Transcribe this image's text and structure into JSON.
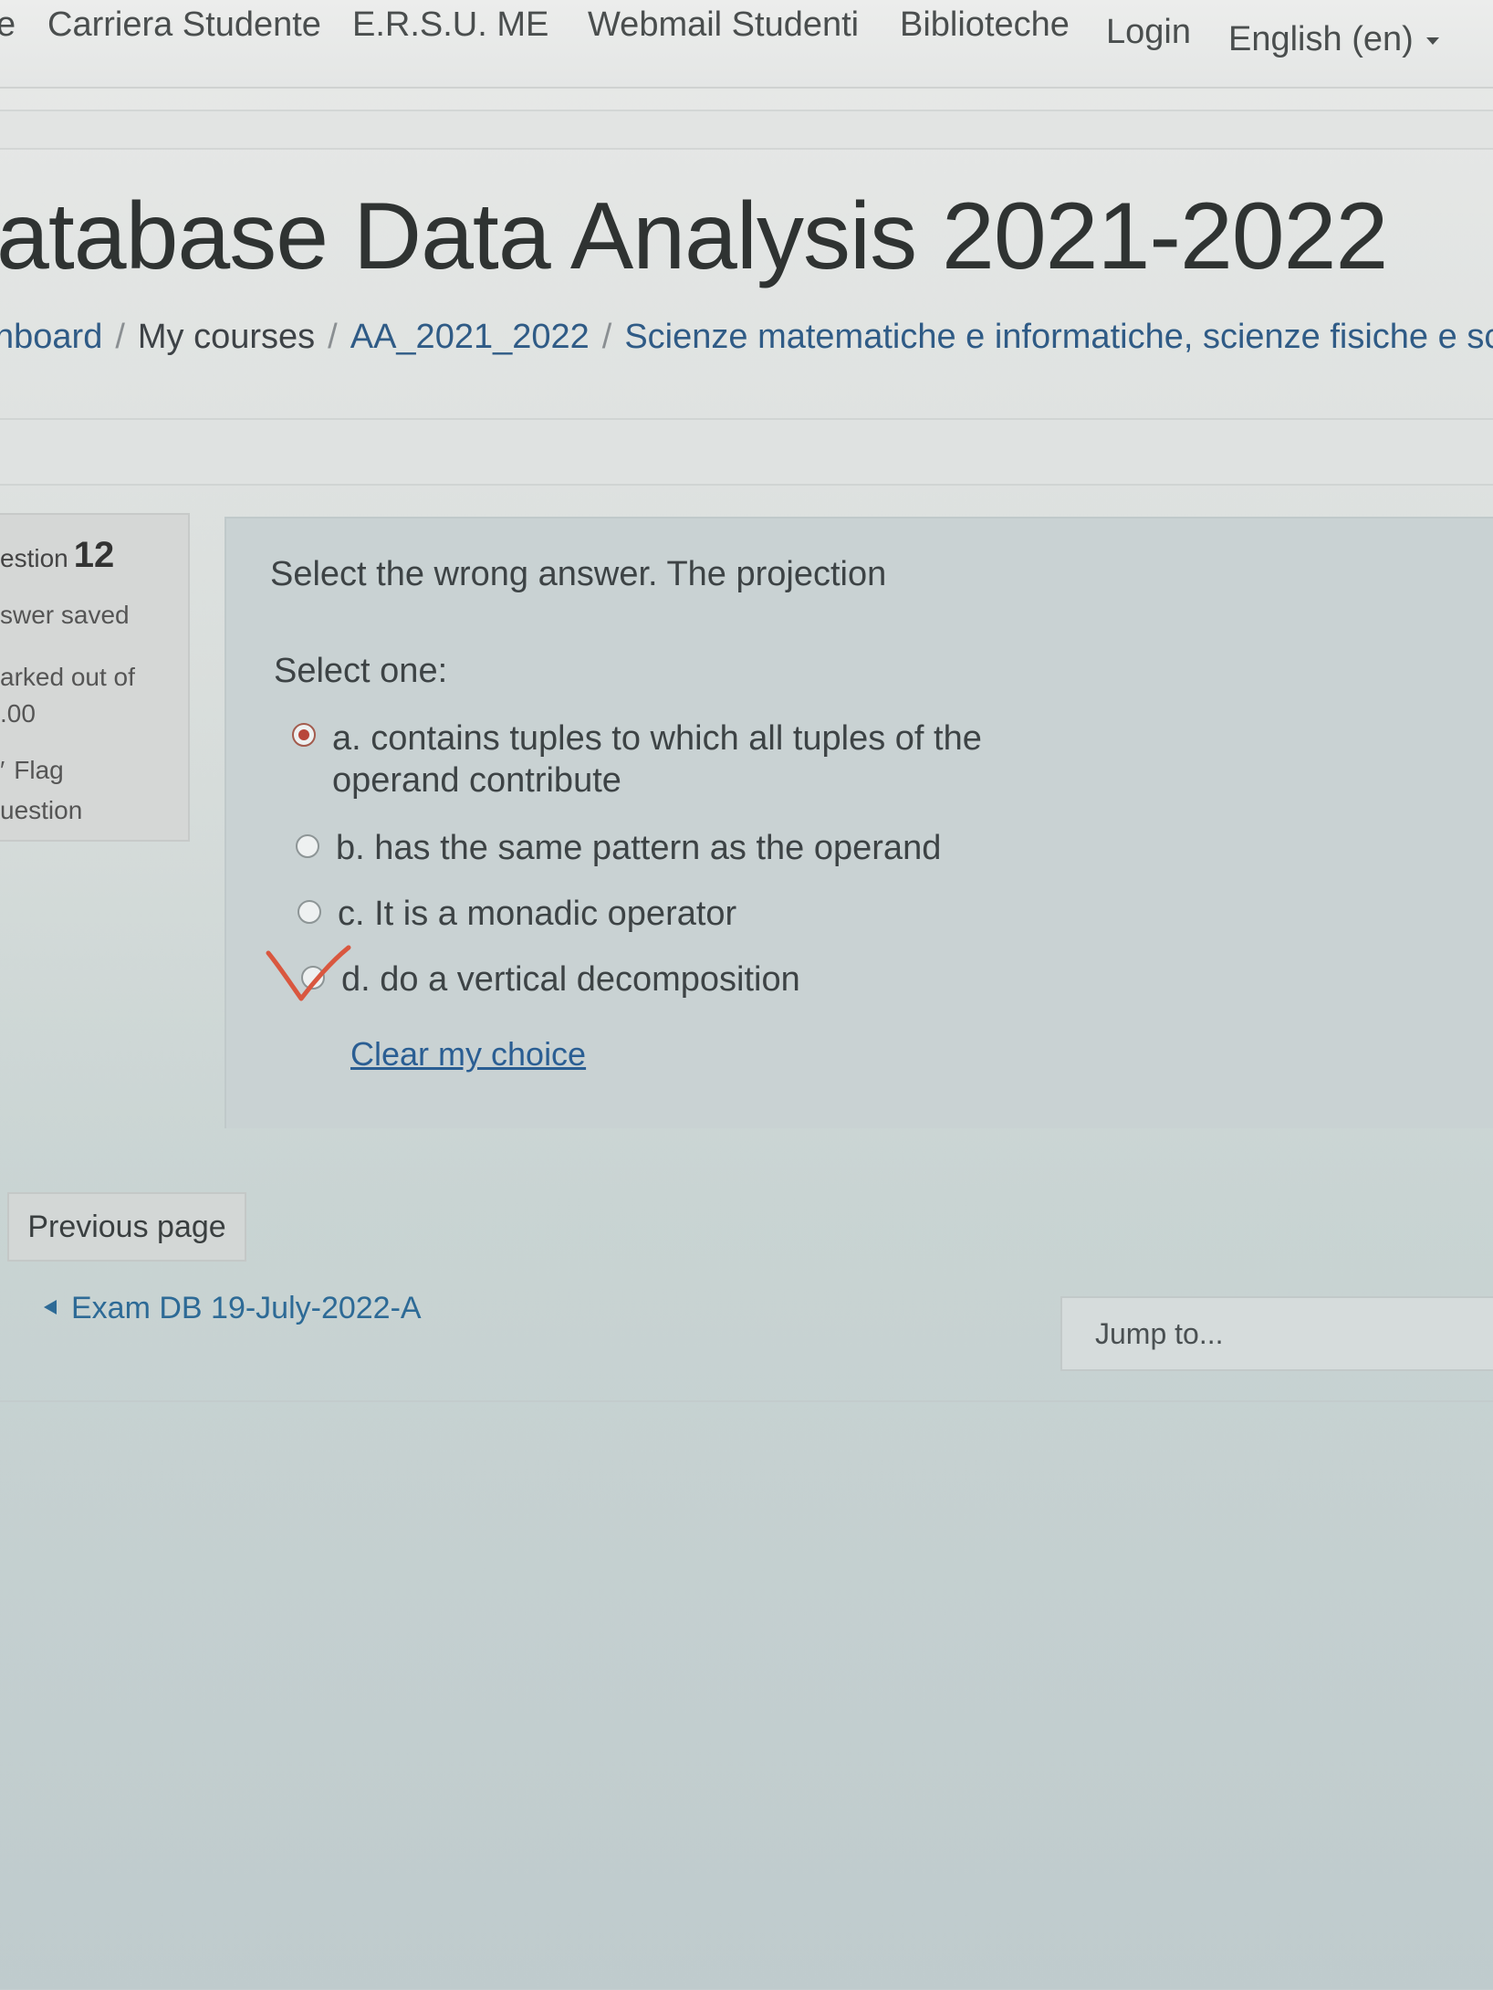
{
  "topnav": {
    "items": [
      "e",
      "Carriera Studente",
      "E.R.S.U. ME",
      "Webmail Studenti",
      "Biblioteche",
      "Login"
    ],
    "language": "English (en)"
  },
  "header": {
    "title": "atabase Data Analysis 2021-2022",
    "breadcrumb": [
      "nboard",
      "My courses",
      "AA_2021_2022",
      "Scienze matematiche e informatiche, scienze fisiche e sc"
    ],
    "separator": "/"
  },
  "question_info": {
    "number_label": "estion",
    "number": "12",
    "state": "swer saved",
    "grade": "arked out of",
    "grade_value": ".00",
    "flag_line1": "Flag",
    "flag_line2": "uestion"
  },
  "question": {
    "text": "Select the wrong answer. The projection",
    "prompt": "Select one:",
    "answers": [
      {
        "label": "a. contains tuples to which all tuples of the operand contribute",
        "selected": true
      },
      {
        "label": "b. has the same pattern as the operand",
        "selected": false
      },
      {
        "label": "c. It is a monadic operator",
        "selected": false
      },
      {
        "label": "d. do a vertical decomposition",
        "selected": false
      }
    ],
    "clear_choice": "Clear my choice"
  },
  "navigation": {
    "previous_page": "Previous page",
    "previous_activity": "Exam DB 19-July-2022-A",
    "jump_to": "Jump to..."
  },
  "colors": {
    "selected_radio": "#b8463a",
    "link": "#2a5e93",
    "pen_mark": "#d9573f"
  }
}
